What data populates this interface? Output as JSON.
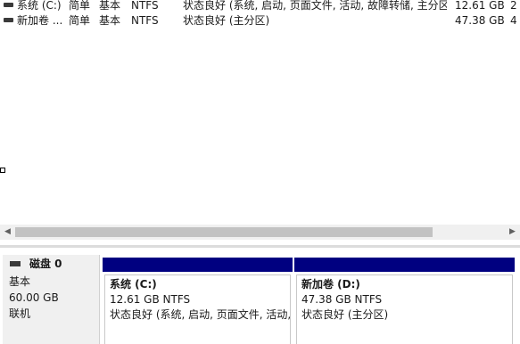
{
  "volumes": [
    {
      "name": "系统 (C:)",
      "layout": "简单",
      "type": "基本",
      "fs": "NTFS",
      "status": "状态良好 (系统, 启动, 页面文件, 活动, 故障转储, 主分区)",
      "capacity": "12.61 GB",
      "free": "2"
    },
    {
      "name": "新加卷 ...",
      "layout": "简单",
      "type": "基本",
      "fs": "NTFS",
      "status": "状态良好 (主分区)",
      "capacity": "47.38 GB",
      "free": "4"
    }
  ],
  "scrollbar": {
    "left_arrow": "◀",
    "right_arrow": "▶"
  },
  "disk": {
    "name": "磁盘 0",
    "type": "基本",
    "size": "60.00 GB",
    "state": "联机"
  },
  "partitions": [
    {
      "title": "系统  (C:)",
      "size": "12.61 GB NTFS",
      "status": "状态良好 (系统, 启动, 页面文件, 活动, 故障转储, 主分区)"
    },
    {
      "title": "新加卷  (D:)",
      "size": "47.38 GB NTFS",
      "status": "状态良好 (主分区)"
    }
  ],
  "colors": {
    "partition_header": "#000080"
  }
}
